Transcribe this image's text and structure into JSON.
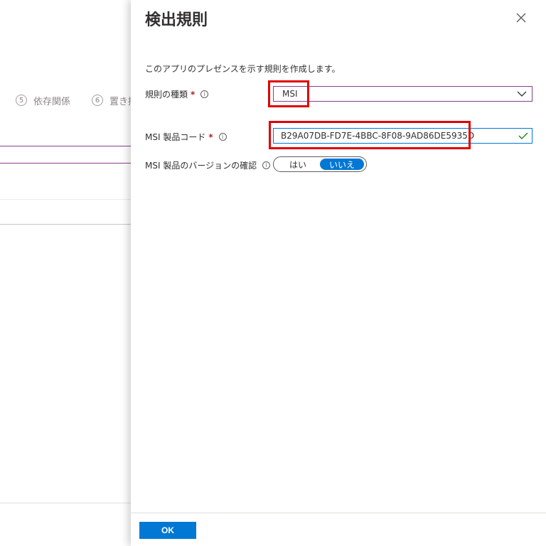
{
  "background": {
    "steps": [
      {
        "number": "5",
        "label": "依存関係"
      },
      {
        "number": "6",
        "label": "置き換え"
      }
    ]
  },
  "panel": {
    "title": "検出規則",
    "description": "このアプリのプレゼンスを示す規則を作成します。",
    "rule_type": {
      "label": "規則の種類",
      "required": "*",
      "value": "MSI"
    },
    "product_code": {
      "label": "MSI 製品コード",
      "required": "*",
      "value": "B29A07DB-FD7E-4BBC-8F08-9AD86DE5935D"
    },
    "version_check": {
      "label": "MSI 製品のバージョンの確認",
      "options": [
        "はい",
        "いいえ"
      ],
      "selected": "いいえ"
    },
    "ok_label": "OK"
  },
  "colors": {
    "accent": "#0078d4",
    "select_border": "#8a3c8f",
    "highlight": "#e00000",
    "required": "#a4262c"
  }
}
